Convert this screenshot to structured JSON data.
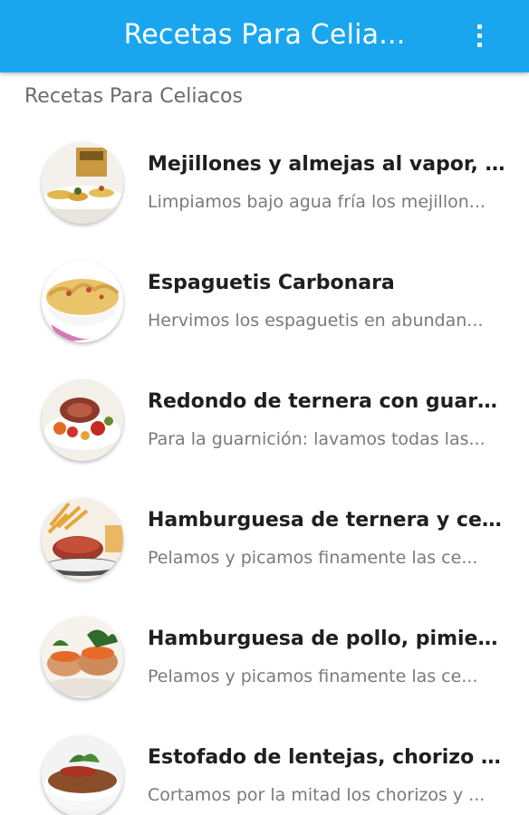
{
  "appbar": {
    "title": "Recetas Para Celia...",
    "menu_icon": "overflow-menu-icon"
  },
  "section": {
    "header": "Recetas Para Celiacos"
  },
  "recipes": [
    {
      "title": "Mejillones y almejas al vapor, ac...",
      "description": "Limpiamos bajo agua fría los mejillon...",
      "image": "seafood-plate"
    },
    {
      "title": "Espaguetis Carbonara",
      "description": "Hervimos los espaguetis en abundan...",
      "image": "pasta-bowl"
    },
    {
      "title": "Redondo de ternera con guarnic...",
      "description": "Para la guarnición: lavamos todas las...",
      "image": "roast-beef-vegetables"
    },
    {
      "title": "Hamburguesa de ternera y cerd...",
      "description": "Pelamos y picamos finamente las ce...",
      "image": "burger-fries"
    },
    {
      "title": "Hamburguesa de pollo, pimient...",
      "description": "Pelamos y picamos finamente las ce...",
      "image": "chicken-burger"
    },
    {
      "title": "Estofado de lentejas, chorizo y ...",
      "description": "Cortamos por la mitad los chorizos y ...",
      "image": "lentil-stew"
    }
  ],
  "colors": {
    "appbar": "#1aa6ee",
    "title_text": "#1f1f1f",
    "desc_text": "#7a7a7a",
    "section_text": "#6b6b6b"
  }
}
